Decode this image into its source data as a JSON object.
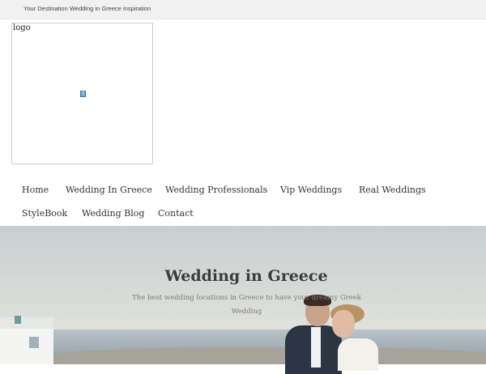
{
  "header": {
    "tagline": "Your Destination Wedding in Greece inspiration",
    "logo_alt": "logo",
    "broken_image_glyph": "?"
  },
  "nav": {
    "items": [
      {
        "label": "Home"
      },
      {
        "label": "Wedding In Greece"
      },
      {
        "label": "Wedding Professionals"
      },
      {
        "label": "Vip Weddings"
      },
      {
        "label": "Real Weddings"
      },
      {
        "label": "StyleBook"
      },
      {
        "label": "Wedding Blog"
      },
      {
        "label": "Contact"
      }
    ]
  },
  "hero": {
    "title": "Wedding in Greece",
    "subtitle": "The best wedding locations in Greece to have your dreamy Greek Wedding"
  }
}
